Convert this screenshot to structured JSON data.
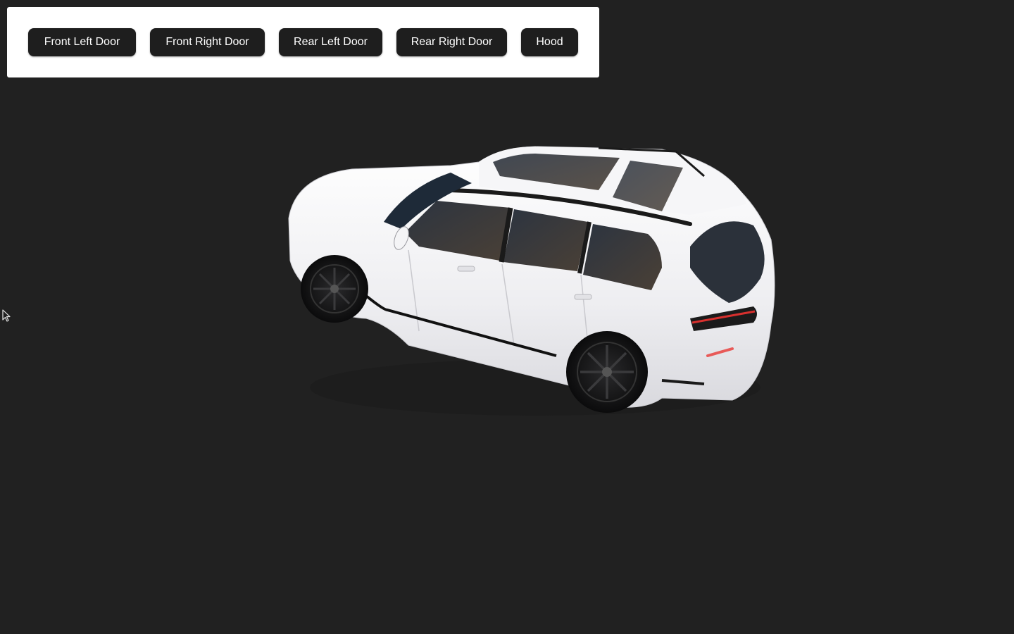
{
  "toolbar": {
    "buttons": {
      "front_left_door": "Front Left Door",
      "front_right_door": "Front Right Door",
      "rear_left_door": "Rear Left Door",
      "rear_right_door": "Rear Right Door",
      "hood": "Hood"
    }
  },
  "scene": {
    "model": "car-model",
    "body_color": "#f2f2f4",
    "background_color": "#212121"
  },
  "cursor": {
    "icon": "mouse-pointer-icon"
  }
}
